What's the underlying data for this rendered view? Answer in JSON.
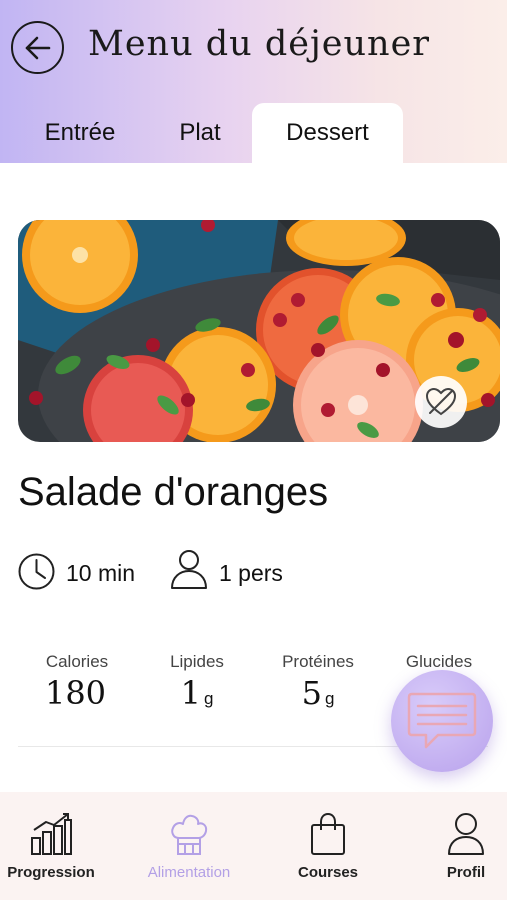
{
  "header": {
    "title": "Menu du déjeuner",
    "back_icon": "arrow-left-circle-icon"
  },
  "tabs": [
    {
      "label": "Entrée",
      "active": false
    },
    {
      "label": "Plat",
      "active": false
    },
    {
      "label": "Dessert",
      "active": true
    }
  ],
  "recipe": {
    "title": "Salade d'oranges",
    "favorite_icon": "heart-slash-icon",
    "duration": "10 min",
    "servings": "1 pers"
  },
  "nutrition": [
    {
      "label": "Calories",
      "value": "180",
      "unit": ""
    },
    {
      "label": "Lipides",
      "value": "1",
      "unit": "g"
    },
    {
      "label": "Protéines",
      "value": "5",
      "unit": "g"
    },
    {
      "label": "Glucides",
      "value": "",
      "unit": ""
    }
  ],
  "bottom_nav": [
    {
      "label": "Progression",
      "icon": "bar-chart-icon",
      "active": false
    },
    {
      "label": "Alimentation",
      "icon": "chef-hat-icon",
      "active": true
    },
    {
      "label": "Courses",
      "icon": "shopping-bag-icon",
      "active": false
    },
    {
      "label": "Profil",
      "icon": "user-icon",
      "active": false
    }
  ],
  "colors": {
    "accent": "#b3a0e6",
    "header_gradient_start": "#c1b5f3",
    "header_gradient_end": "#fbeee9",
    "nav_background": "#fbf3f2"
  }
}
